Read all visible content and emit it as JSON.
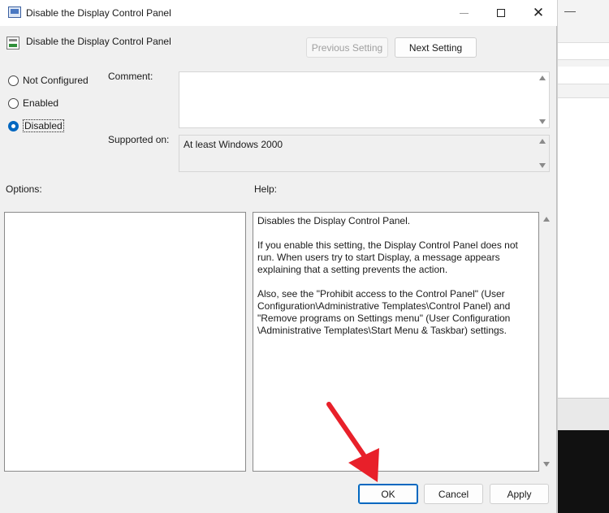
{
  "window": {
    "title": "Disable the Display Control Panel",
    "minimize": "—",
    "maximize": "",
    "close": "✕"
  },
  "policy": {
    "name": "Disable the Display Control Panel"
  },
  "nav": {
    "previous_label": "Previous Setting",
    "next_label": "Next Setting"
  },
  "state": {
    "options": [
      {
        "label": "Not Configured",
        "checked": false
      },
      {
        "label": "Enabled",
        "checked": false
      },
      {
        "label": "Disabled",
        "checked": true
      }
    ]
  },
  "comment": {
    "label": "Comment:",
    "value": ""
  },
  "supported": {
    "label": "Supported on:",
    "value": "At least Windows 2000"
  },
  "options_panel": {
    "label": "Options:"
  },
  "help_panel": {
    "label": "Help:",
    "paragraphs": [
      "Disables the Display Control Panel.",
      "If you enable this setting, the Display Control Panel does not run. When users try to start Display, a message appears explaining that a setting prevents the action.",
      "Also, see the \"Prohibit access to the Control Panel\" (User Configuration\\Administrative Templates\\Control Panel) and \"Remove programs on Settings menu\" (User Configuration \\Administrative Templates\\Start Menu & Taskbar) settings."
    ]
  },
  "footer": {
    "ok_label": "OK",
    "cancel_label": "Cancel",
    "apply_label": "Apply"
  },
  "colors": {
    "accent": "#0067c0",
    "annotation_arrow": "#e8202a",
    "dialog_bg": "#f0f0f0"
  }
}
